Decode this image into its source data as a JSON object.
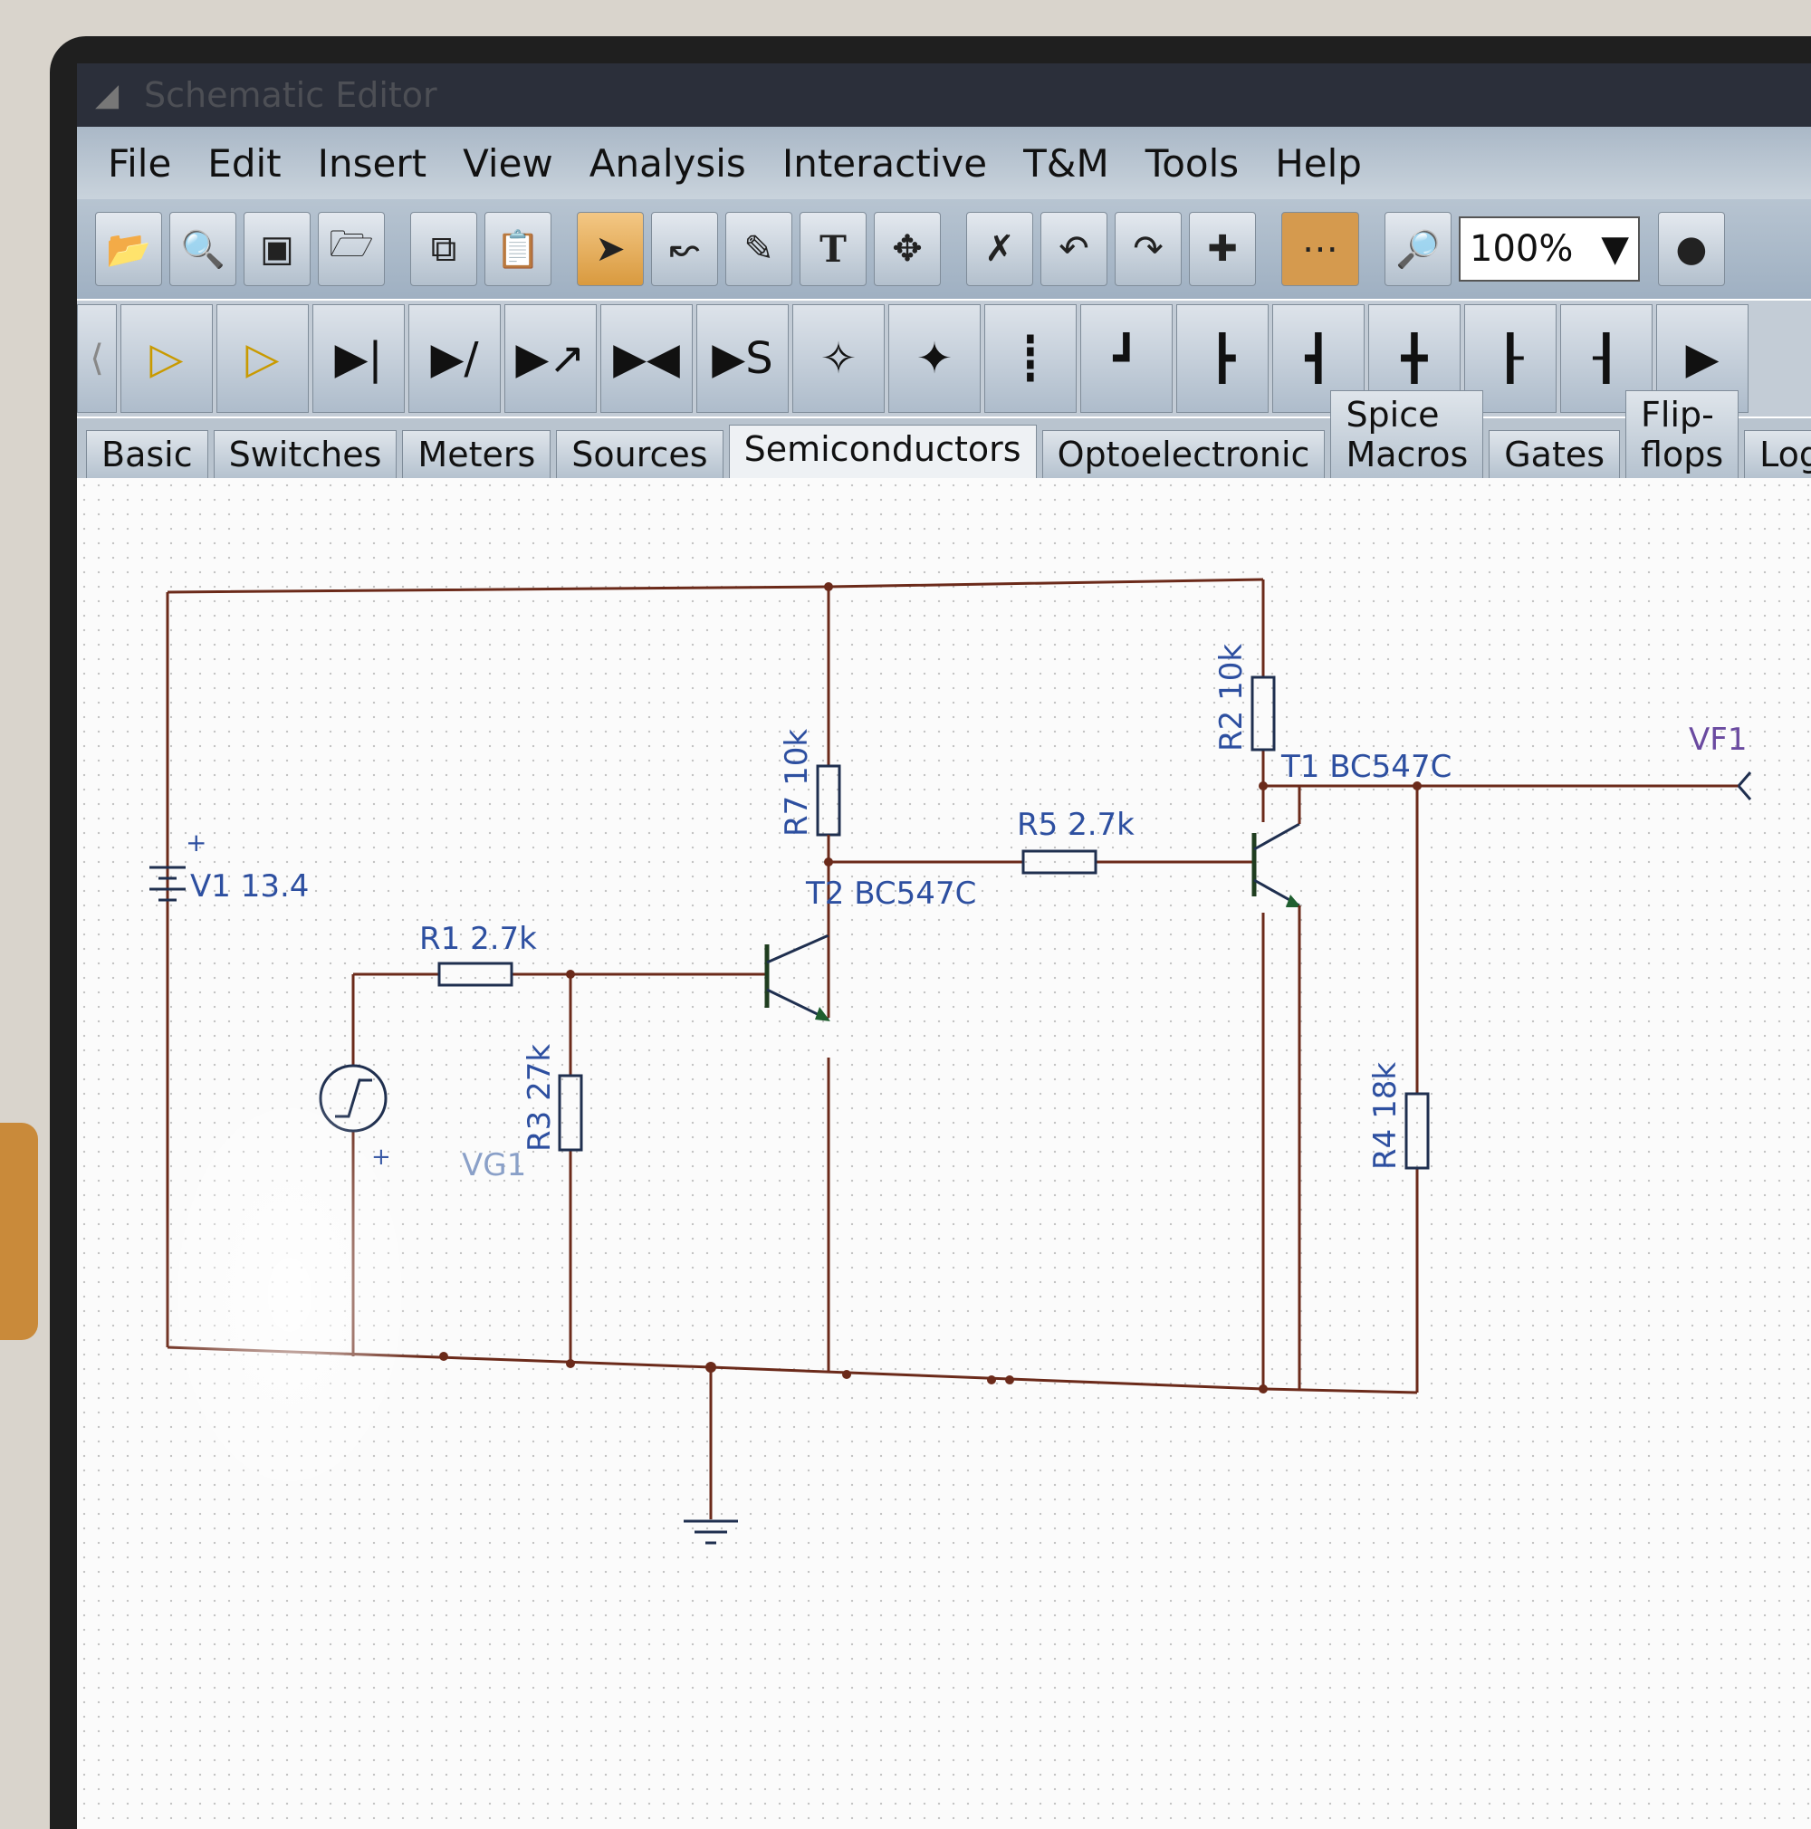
{
  "window": {
    "title": "Schematic Editor"
  },
  "menu": {
    "items": [
      "File",
      "Edit",
      "Insert",
      "View",
      "Analysis",
      "Interactive",
      "T&M",
      "Tools",
      "Help"
    ]
  },
  "toolbar": {
    "zoom_value": "100%",
    "text_tool_label": "T",
    "buttons": [
      "open-folder-icon",
      "find-icon",
      "save-icon",
      "open-icon",
      "copy-icon",
      "paste-icon",
      "pointer-icon",
      "wire-icon",
      "pencil-icon",
      "text-icon",
      "draw-icon",
      "delete-icon",
      "undo-icon",
      "redo-icon",
      "junction-icon",
      "grid-icon",
      "zoom-icon",
      "probe-icon"
    ]
  },
  "component_bar": {
    "items": [
      "opamp-icon",
      "opamp2-icon",
      "diode-icon",
      "zener-icon",
      "led-icon",
      "diac-icon",
      "schottky-icon",
      "npn-icon",
      "pnp-icon",
      "nmos-icon",
      "pmos-icon",
      "nmos2-icon",
      "pmos2-icon",
      "nmos3-icon",
      "jfet-n-icon",
      "jfet-p-icon",
      "scroll-right-icon"
    ]
  },
  "tabs": {
    "items": [
      "Basic",
      "Switches",
      "Meters",
      "Sources",
      "Semiconductors",
      "Optoelectronic",
      "Spice Macros",
      "Gates",
      "Flip-flops",
      "Logic"
    ],
    "selected": "Semiconductors"
  },
  "schematic": {
    "v1": "V1 13.4",
    "v1_plus": "+",
    "r1": "R1 2.7k",
    "vg1": "VG1",
    "vg1_plus": "+",
    "r3": "R3 27k",
    "r7": "R7 10k",
    "t2": "T2 BC547C",
    "r5": "R5 2.7k",
    "r2": "R2 10k",
    "t1": "T1 BC547C",
    "vf1": "VF1",
    "r4": "R4 18k"
  },
  "colors": {
    "wire": "#6b2a1a",
    "label": "#2d4fa0",
    "transistor": "#1f3d1f",
    "tab_selected": "#eef1f4"
  }
}
